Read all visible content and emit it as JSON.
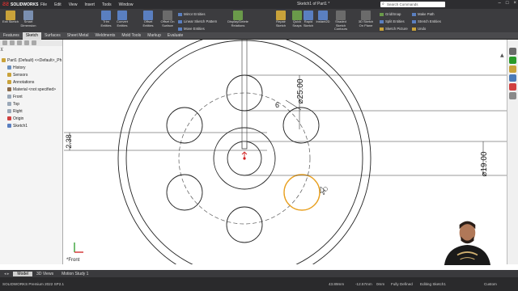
{
  "app": {
    "logo_text": "SOLIDWORKS",
    "menu": [
      "File",
      "Edit",
      "View",
      "Insert",
      "Tools",
      "Window"
    ],
    "doc_title": "Sketch1 of Part1 *",
    "search_placeholder": "Search Commands"
  },
  "ribbon": {
    "big_buttons": [
      {
        "label": "Exit Sketch",
        "icon": "exit-sketch-icon",
        "color": "#c9a23a"
      },
      {
        "label": "Smart Dimension",
        "icon": "smart-dimension-icon",
        "color": "#7a8fb0"
      },
      {
        "label": "Trim Entities",
        "icon": "trim-icon",
        "color": "#5a7fc0"
      },
      {
        "label": "Convert Entities",
        "icon": "convert-icon",
        "color": "#5a7fc0"
      },
      {
        "label": "Offset Entities",
        "icon": "offset-icon",
        "color": "#5a7fc0"
      },
      {
        "label": "Offset On Surface",
        "icon": "offset-surface-icon",
        "color": "#6b6b6b"
      },
      {
        "label": "Display/Delete Relations",
        "icon": "relations-icon",
        "color": "#6a9a4a"
      },
      {
        "label": "Repair Sketch",
        "icon": "repair-icon",
        "color": "#c9a23a"
      },
      {
        "label": "Quick Snaps",
        "icon": "quick-snaps-icon",
        "color": "#6a9a4a"
      },
      {
        "label": "Rapid Sketch",
        "icon": "rapid-sketch-icon",
        "color": "#5a7fc0"
      },
      {
        "label": "Instant2D",
        "icon": "instant2d-icon",
        "color": "#5a7fc0"
      },
      {
        "label": "Shaded Sketch Contours",
        "icon": "shaded-contours-icon",
        "color": "#6b6b6b"
      },
      {
        "label": "3D Sketch On Plane",
        "icon": "sketch-3d-icon",
        "color": "#6b6b6b"
      }
    ],
    "small_buttons": [
      {
        "label": "Mirror Entities"
      },
      {
        "label": "Linear Sketch Pattern"
      },
      {
        "label": "Move Entities"
      },
      {
        "label": "Grid/Snap"
      },
      {
        "label": "Split Entities"
      },
      {
        "label": "Sketch Picture"
      },
      {
        "label": "Make Path"
      },
      {
        "label": "Stretch Entities"
      },
      {
        "label": "Undo"
      }
    ]
  },
  "tabs": [
    "Features",
    "Sketch",
    "Surfaces",
    "Sheet Metal",
    "Weldments",
    "Mold Tools",
    "Markup",
    "Evaluate"
  ],
  "tree": {
    "root": "Part1 (Default) <<Default>_Ph",
    "items": [
      "History",
      "Sensors",
      "Annotations",
      "Material <not specified>",
      "Front",
      "Top",
      "Right",
      "Origin",
      "Sketch1"
    ]
  },
  "canvas": {
    "dims": {
      "d1": "⌀25.00",
      "d2": "6",
      "d3": "2.38",
      "d4": "⌀19.00"
    },
    "view_label": "*Front",
    "highlight_color": "#e8a020"
  },
  "bottom_tabs": [
    "Model",
    "3D Views",
    "Motion Study 1"
  ],
  "status": {
    "app_version": "SOLIDWORKS Premium 2022 SP2.1",
    "x": "43.89mm",
    "y": "-12.57mm",
    "z": "0mm",
    "state": "Fully Defined",
    "editing": "Editing Sketch1",
    "units": "Custom"
  }
}
